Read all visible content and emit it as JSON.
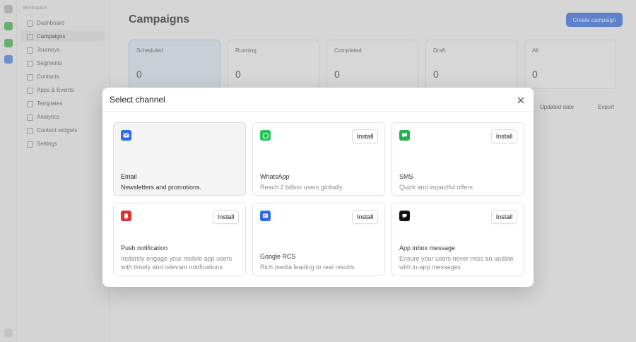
{
  "background": {
    "sidebar_heading": "Workspace",
    "sidebar_items": [
      "Dashboard",
      "Campaigns",
      "Journeys",
      "Segments",
      "Contacts",
      "Apps & Events",
      "Templates",
      "Analytics",
      "Content widgets",
      "Settings"
    ],
    "page_title": "Campaigns",
    "primary_button": "Create campaign",
    "stats": [
      {
        "label": "Scheduled",
        "value": "0"
      },
      {
        "label": "Running",
        "value": "0"
      },
      {
        "label": "Completed",
        "value": "0"
      },
      {
        "label": "Draft",
        "value": "0"
      },
      {
        "label": "All",
        "value": "0"
      }
    ],
    "filter_label": "Updated date",
    "export_label": "Export"
  },
  "dialog": {
    "title": "Select channel",
    "install_label": "Install",
    "channels": [
      {
        "name": "Email",
        "description": "Newsletters and promotions.",
        "icon": "mail-icon",
        "color": "#2f6bea"
      },
      {
        "name": "WhatsApp",
        "description": "Reach 2 billion users globally.",
        "icon": "whatsapp-icon",
        "color": "#25c35b"
      },
      {
        "name": "SMS",
        "description": "Quick and impactful offers.",
        "icon": "sms-icon",
        "color": "#22b04f"
      },
      {
        "name": "Push notification",
        "description": "Instantly engage your mobile app users with timely and relevant notifications",
        "icon": "bell-icon",
        "color": "#e03131"
      },
      {
        "name": "Google RCS",
        "description": "Rich media leading to real results.",
        "icon": "rcs-icon",
        "color": "#2f6bea"
      },
      {
        "name": "App inbox message",
        "description": "Ensure your users never miss an update with in-app messages",
        "icon": "inbox-icon",
        "color": "#111111"
      }
    ]
  }
}
